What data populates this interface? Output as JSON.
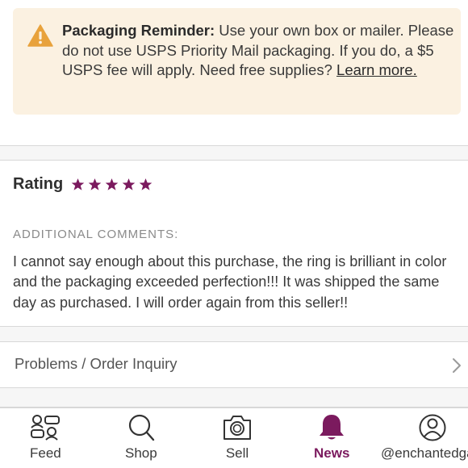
{
  "reminder": {
    "title": "Packaging Reminder:",
    "body": " Use your own box or mailer. Please do not use USPS Priority Mail packaging. If you do, a $5 USPS fee will apply. Need free supplies? ",
    "link": "Learn more."
  },
  "rating": {
    "label": "Rating",
    "stars": 5,
    "max_stars": 5,
    "star_color": "#7b1a5e"
  },
  "comments": {
    "title": "ADDITIONAL COMMENTS:",
    "text": "I cannot say enough about this purchase, the ring is brilliant in color and the packaging exceeded perfection!!! It was shipped the same day as purchased. I will order again from this seller!!"
  },
  "inquiry": {
    "label": "Problems / Order Inquiry"
  },
  "tabbar": {
    "items": [
      {
        "label": "Feed",
        "icon": "feed-icon"
      },
      {
        "label": "Shop",
        "icon": "search-icon"
      },
      {
        "label": "Sell",
        "icon": "camera-icon"
      },
      {
        "label": "News",
        "icon": "bell-icon",
        "active": true
      },
      {
        "label": "@enchantedgalri",
        "icon": "profile-icon"
      }
    ],
    "active_color": "#7b1a5e"
  }
}
